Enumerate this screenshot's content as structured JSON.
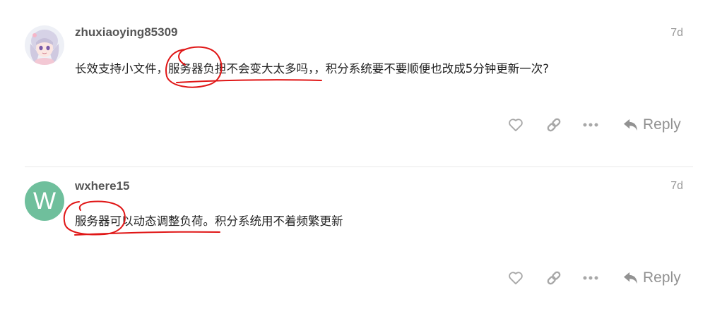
{
  "posts": [
    {
      "username": "zhuxiaoying85309",
      "time": "7d",
      "text": "长效支持小文件，服务器负担不会变大太多吗，，积分系统要不要顺便也改成5分钟更新一次?",
      "reply_label": "Reply"
    },
    {
      "username": "wxhere15",
      "avatar_letter": "W",
      "time": "7d",
      "text": "服务器可以动态调整负荷。积分系统用不着频繁更新",
      "reply_label": "Reply"
    }
  ],
  "colors": {
    "avatar_w": "#6fbf9c",
    "icon": "#a8a8a8",
    "annotation": "#e01616"
  }
}
